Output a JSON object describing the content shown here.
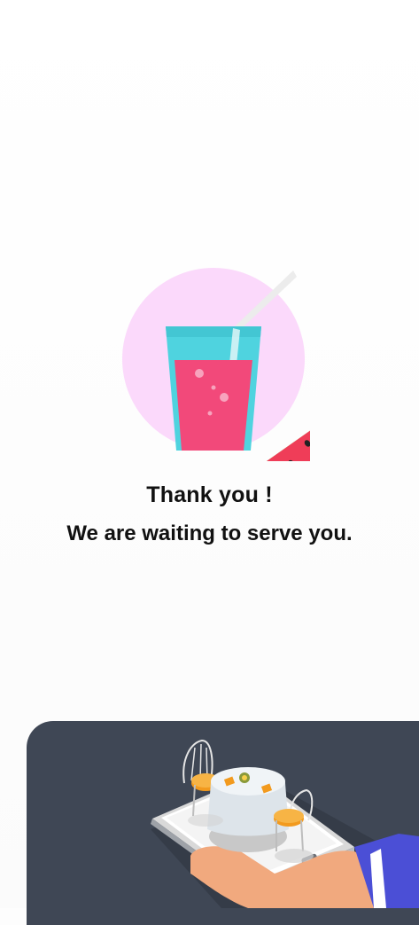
{
  "message": {
    "title": "Thank you !",
    "subtitle": "We are waiting to serve you."
  },
  "illustrations": {
    "hero": "juice-glass-with-watermelon-illustration",
    "footer": "hand-holding-phone-with-restaurant-table-illustration"
  },
  "colors": {
    "background": "#fdfdfd",
    "circle": "#fbd9fb",
    "glass": "#4fd3df",
    "juice": "#f2497a",
    "watermelon_flesh": "#ef3d58",
    "watermelon_rind": "#8bd35a",
    "card": "#3f4755"
  }
}
